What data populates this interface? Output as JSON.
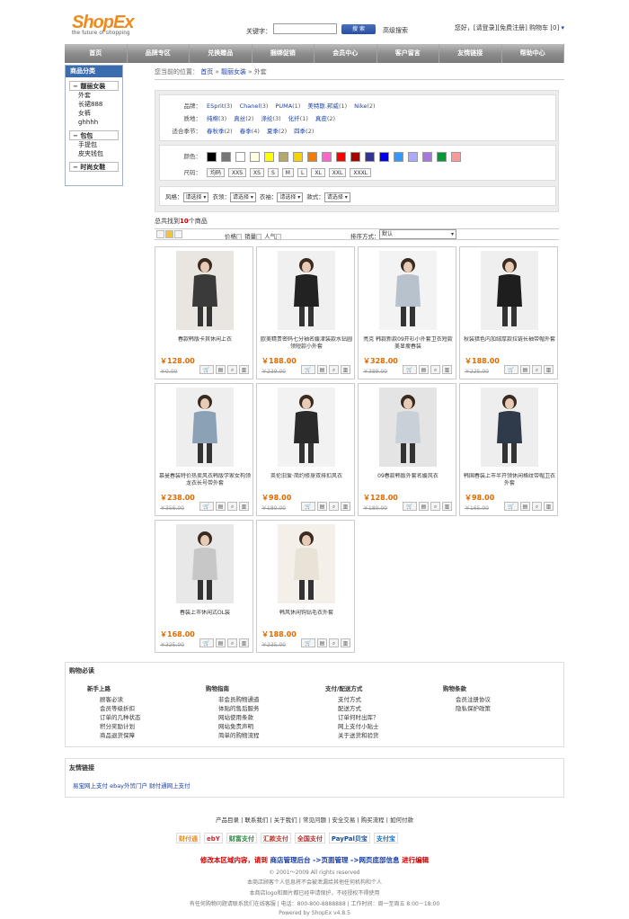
{
  "header": {
    "logo_main": "ShopEx",
    "logo_sub": "the future of shopping",
    "keyword_label": "关键字：",
    "search_button": "搜 索",
    "advanced_search": "高级搜索",
    "greeting": "您好，",
    "login": "[请登录]",
    "register": "[免费注册]",
    "cart": "购物车",
    "cart_count": "[0]"
  },
  "nav": [
    "首页",
    "品牌专区",
    "兑换赠品",
    "捆绑促销",
    "会员中心",
    "客户留言",
    "友情链接",
    "帮助中心"
  ],
  "sidebar": {
    "title": "商品分类",
    "groups": [
      {
        "name": "靓丽女装",
        "items": [
          "外套",
          "长裙888",
          "女裤",
          "ghhhh"
        ]
      },
      {
        "name": "包包",
        "items": [
          "手提包",
          "皮夹钱包"
        ]
      },
      {
        "name": "时尚女鞋",
        "items": []
      }
    ]
  },
  "breadcrumb": {
    "prefix": "您当前的位置：",
    "home": "首页",
    "cat": "靓丽女装",
    "current": "外套"
  },
  "filter": {
    "brand_label": "品牌：",
    "brands": [
      {
        "n": "ESprit",
        "c": "(3)"
      },
      {
        "n": "Chanel",
        "c": "(3)"
      },
      {
        "n": "PUMA",
        "c": "(1)"
      },
      {
        "n": "美特斯.邦威",
        "c": "(1)"
      },
      {
        "n": "Nike",
        "c": "(2)"
      }
    ],
    "material_label": "质地：",
    "materials": [
      {
        "n": "纯棉",
        "c": "(3)"
      },
      {
        "n": "真丝",
        "c": "(2)"
      },
      {
        "n": "涤纶",
        "c": "(3)"
      },
      {
        "n": "化纤",
        "c": "(1)"
      },
      {
        "n": "真皮",
        "c": "(2)"
      }
    ],
    "season_label": "适合季节：",
    "seasons": [
      {
        "n": "春秋季",
        "c": "(2)"
      },
      {
        "n": "春季",
        "c": "(4)"
      },
      {
        "n": "夏季",
        "c": "(2)"
      },
      {
        "n": "四季",
        "c": "(2)"
      }
    ],
    "color_label": "颜色：",
    "colors": [
      "#000000",
      "#777777",
      "#ffffff",
      "#fffde0",
      "#ffff00",
      "#b5a96a",
      "#f5d300",
      "#f07c00",
      "#ff66cc",
      "#ff0000",
      "#aa0000",
      "#333399",
      "#0000ee",
      "#3399ff",
      "#aaaaff",
      "#aa77dd",
      "#009933",
      "#ff9999"
    ],
    "size_label": "尺码：",
    "sizes": [
      "均码",
      "XXS",
      "XS",
      "S",
      "M",
      "L",
      "XL",
      "XXL",
      "XXXL"
    ],
    "selects": [
      {
        "label": "风格：",
        "value": "请选择"
      },
      {
        "label": "衣领：",
        "value": "请选择"
      },
      {
        "label": "衣袖：",
        "value": "请选择"
      },
      {
        "label": "款式：",
        "value": "请选择"
      }
    ]
  },
  "results": {
    "prefix": "总共找到",
    "count": "10",
    "suffix": "个商品"
  },
  "toolbar": {
    "sort1": "价格",
    "sort2": "销量",
    "sort3": "人气",
    "sort_label": "排序方式：",
    "sort_value": "默认"
  },
  "products": [
    {
      "title": "春款韩版卡其休闲上衣",
      "price": "￥128.00",
      "old": "￥0.00",
      "bg": "#e9e6e2",
      "fig": "#3a3a3a"
    },
    {
      "title": "欧美精贵密码七分袖名媛津装款水钻圆领短款小外套",
      "price": "￥188.00",
      "old": "￥239.00",
      "bg": "#f0f0f0",
      "fig": "#222222"
    },
    {
      "title": "亮克 韩款新款09开衫小外套卫衣短款美显瘦春装",
      "price": "￥328.00",
      "old": "￥389.00",
      "bg": "#f3f3f3",
      "fig": "#b8c2cc"
    },
    {
      "title": "秋装猎色内加绒厚款拉链长袖带帽外套",
      "price": "￥188.00",
      "old": "￥225.00",
      "bg": "#efefef",
      "fig": "#1e1e1e"
    },
    {
      "title": "慕曼春装特价热卖风衣韩版学家女构领龙衣长号带外套",
      "price": "￥238.00",
      "old": "￥356.00",
      "bg": "#eeeeee",
      "fig": "#8aa1b6"
    },
    {
      "title": "英伦旧爱·简约修身双排扣风衣",
      "price": "￥98.00",
      "old": "￥180.00",
      "bg": "#f2f2f2",
      "fig": "#2a2a2a"
    },
    {
      "title": "09春款韩版外套名媛风衣",
      "price": "￥128.00",
      "old": "￥180.00",
      "bg": "#e4e4e4",
      "fig": "#c9d0d8"
    },
    {
      "title": "韩国春装上市半开领休闲格纹带帽卫衣外套",
      "price": "￥98.00",
      "old": "￥165.00",
      "bg": "#eeeeee",
      "fig": "#2f3b4a"
    },
    {
      "title": "春装上市休闲式OL装",
      "price": "￥168.00",
      "old": "￥325.00",
      "bg": "#e8e8e8",
      "fig": "#c7c7c7"
    },
    {
      "title": "韩风休闲钩钻毛衣外套",
      "price": "￥188.00",
      "old": "￥235.00",
      "bg": "#f4efe8",
      "fig": "#e9e2d6"
    }
  ],
  "buy_guide": {
    "title": "购物必读",
    "columns": [
      {
        "head": "新手上路",
        "items": [
          "顾客必读",
          "会员等级折扣",
          "订单的几种状态",
          "积分奖励计划",
          "商品退货保障"
        ]
      },
      {
        "head": "购物指南",
        "items": [
          "非会员购物通道",
          "体贴的售后服务",
          "网站使用条款",
          "网站免责声明",
          "简单的购物流程"
        ]
      },
      {
        "head": "支付/配送方式",
        "items": [
          "支付方式",
          "配送方式",
          "订单何时出库？",
          "网上支付小贴士",
          "关于送货和验货"
        ]
      },
      {
        "head": "购物条款",
        "items": [
          "会员注册协议",
          "隐私保护政策"
        ]
      }
    ]
  },
  "friend_links": {
    "title": "友情链接",
    "value": "易宝网上支付 ebay外贸门户 财付通网上支付"
  },
  "footer": {
    "links": "产品目录 | 联系我们 | 关于我们 | 常见问题 | 安全交易 | 购买流程 | 如何付款",
    "badges": [
      "财付通",
      "ebY",
      "财富支付",
      "汇款支付",
      "全国支付",
      "PayPal贝宝",
      "支付宝"
    ],
    "edit_a": "修改本区域内容，请到",
    "edit_b": "商店管理后台",
    "edit_c": "->页面管理",
    "edit_d": "->网页底部信息",
    "edit_e": "进行编辑",
    "copy1": "© 2001～2009 All rights reserved",
    "copy2": "本商店顾客个人信息将不会被泄漏给其他任何机构和个人",
    "copy3": "本商店logo和图片都已经申请保护，不经授权不得使用",
    "copy4": "有任何购物问题请联系我们在线客服 | 电话：800-800-8888888 | 工作时间：周一至周五 8:00－18:00",
    "copy5": "Powered by ShopEx v4.8.5"
  }
}
